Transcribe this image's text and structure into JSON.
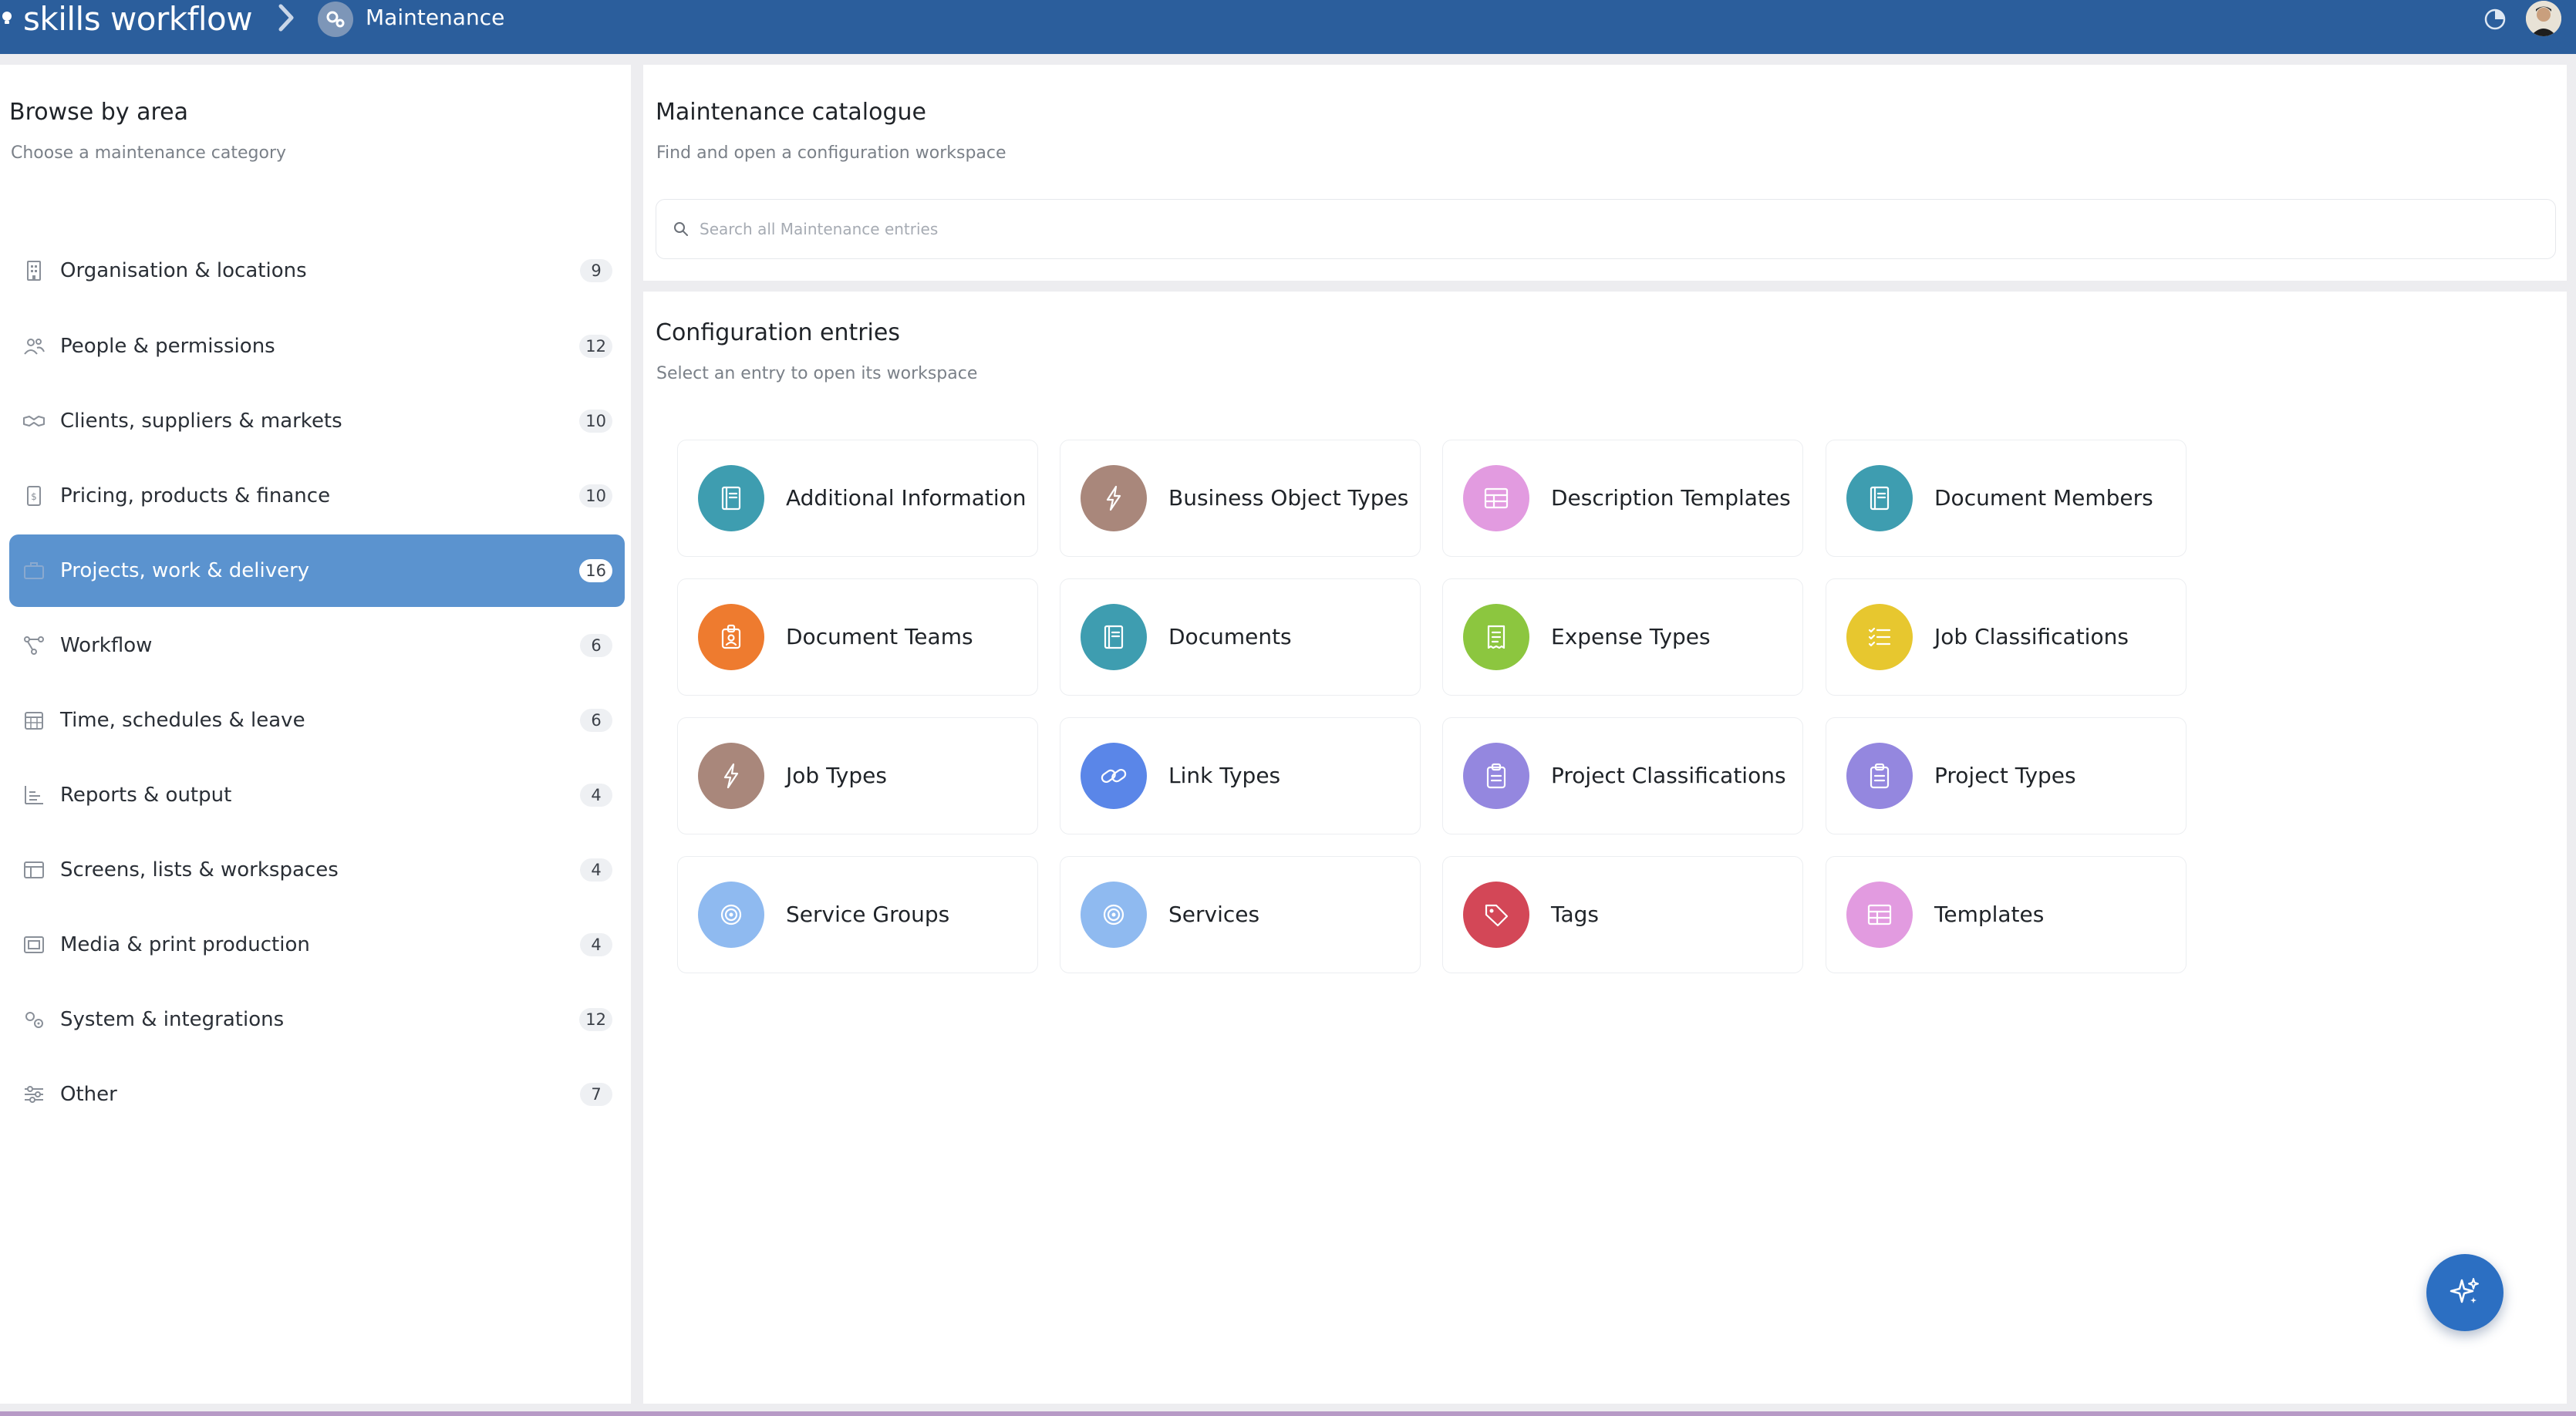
{
  "app": {
    "brand": "skills workflow",
    "breadcrumb": "Maintenance"
  },
  "sidebar": {
    "title": "Browse by area",
    "subtitle": "Choose a maintenance category",
    "items": [
      {
        "label": "Organisation & locations",
        "count": "9",
        "icon": "building-icon"
      },
      {
        "label": "People & permissions",
        "count": "12",
        "icon": "people-icon"
      },
      {
        "label": "Clients, suppliers & markets",
        "count": "10",
        "icon": "handshake-icon"
      },
      {
        "label": "Pricing, products & finance",
        "count": "10",
        "icon": "invoice-icon"
      },
      {
        "label": "Projects, work & delivery",
        "count": "16",
        "icon": "briefcase-icon",
        "active": true
      },
      {
        "label": "Workflow",
        "count": "6",
        "icon": "workflow-icon"
      },
      {
        "label": "Time, schedules & leave",
        "count": "6",
        "icon": "calendar-icon"
      },
      {
        "label": "Reports & output",
        "count": "4",
        "icon": "bar-chart-icon"
      },
      {
        "label": "Screens, lists & workspaces",
        "count": "4",
        "icon": "layout-icon"
      },
      {
        "label": "Media & print production",
        "count": "4",
        "icon": "media-icon"
      },
      {
        "label": "System & integrations",
        "count": "12",
        "icon": "gears-icon"
      },
      {
        "label": "Other",
        "count": "7",
        "icon": "sliders-icon"
      }
    ]
  },
  "catalogue": {
    "title": "Maintenance catalogue",
    "subtitle": "Find and open a configuration workspace",
    "search_placeholder": "Search all Maintenance entries"
  },
  "config": {
    "title": "Configuration entries",
    "subtitle": "Select an entry to open its workspace",
    "entries": [
      {
        "label": "Additional Information",
        "icon": "book-icon",
        "color": "#3e9db0"
      },
      {
        "label": "Business Object Types",
        "icon": "bolt-icon",
        "color": "#a9877b"
      },
      {
        "label": "Description Templates",
        "icon": "table-icon",
        "color": "#e29be0"
      },
      {
        "label": "Document Members",
        "icon": "book-icon",
        "color": "#3e9db0"
      },
      {
        "label": "Document Teams",
        "icon": "badge-icon",
        "color": "#ee7b2f"
      },
      {
        "label": "Documents",
        "icon": "book-icon",
        "color": "#3e9db0"
      },
      {
        "label": "Expense Types",
        "icon": "receipt-icon",
        "color": "#8cc63f"
      },
      {
        "label": "Job Classifications",
        "icon": "checklist-icon",
        "color": "#e7c72f"
      },
      {
        "label": "Job Types",
        "icon": "bolt-icon",
        "color": "#a9877b"
      },
      {
        "label": "Link Types",
        "icon": "link-icon",
        "color": "#5a86e8"
      },
      {
        "label": "Project Classifications",
        "icon": "clipboard-icon",
        "color": "#9487df"
      },
      {
        "label": "Project Types",
        "icon": "clipboard-icon",
        "color": "#9487df"
      },
      {
        "label": "Service Groups",
        "icon": "target-icon",
        "color": "#8fbaf0"
      },
      {
        "label": "Services",
        "icon": "target-icon",
        "color": "#8fbaf0"
      },
      {
        "label": "Tags",
        "icon": "tag-icon",
        "color": "#d34757"
      },
      {
        "label": "Templates",
        "icon": "table-icon",
        "color": "#e29be0"
      }
    ]
  },
  "colors": {
    "topbar": "#2b5e9c",
    "active_item": "#5b93cf",
    "fab": "#2c6fc2"
  }
}
